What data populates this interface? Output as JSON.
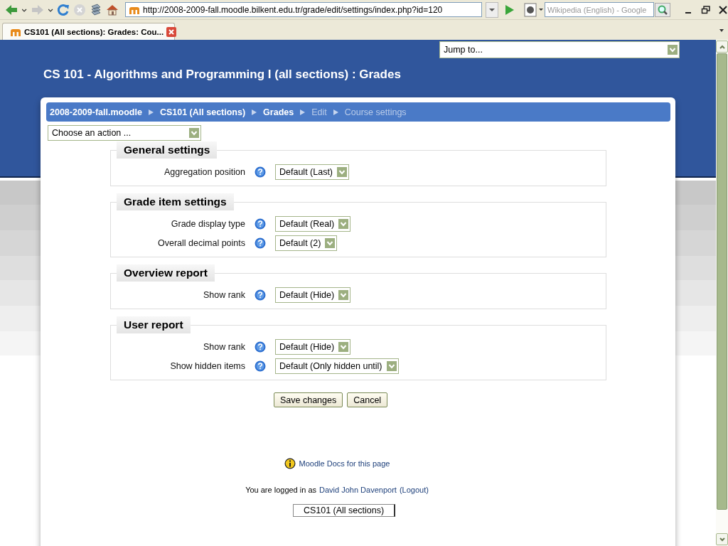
{
  "browser": {
    "address": "http://2008-2009-fall.moodle.bilkent.edu.tr/grade/edit/settings/index.php?id=120",
    "search_placeholder": "Wikipedia (English) - Google",
    "tabs": [
      {
        "title": "CS101 (All sections): Grades: Cou...",
        "selected": true
      }
    ]
  },
  "page": {
    "jump_to": "Jump to...",
    "course_title": "CS 101 - Algorithms and Programming I (all sections) : Grades",
    "breadcrumb": [
      {
        "label": "2008-2009-fall.moodle",
        "link": true
      },
      {
        "label": "CS101 (All sections)",
        "link": true
      },
      {
        "label": "Grades",
        "link": true
      },
      {
        "label": "Edit",
        "link": false
      },
      {
        "label": "Course settings",
        "link": false
      }
    ],
    "action_select": "Choose an action ...",
    "sections": [
      {
        "title": "General settings",
        "settings": [
          {
            "label": "Aggregation position",
            "value": "Default (Last)"
          }
        ]
      },
      {
        "title": "Grade item settings",
        "settings": [
          {
            "label": "Grade display type",
            "value": "Default (Real)"
          },
          {
            "label": "Overall decimal points",
            "value": "Default (2)"
          }
        ]
      },
      {
        "title": "Overview report",
        "settings": [
          {
            "label": "Show rank",
            "value": "Default (Hide)"
          }
        ]
      },
      {
        "title": "User report",
        "settings": [
          {
            "label": "Show rank",
            "value": "Default (Hide)"
          },
          {
            "label": "Show hidden items",
            "value": "Default (Only hidden until)"
          }
        ]
      }
    ],
    "buttons": [
      "Save changes",
      "Cancel"
    ],
    "docs_link": "Moodle Docs for this page",
    "login": {
      "prefix": "You are logged in as",
      "user": "David John Davenport",
      "logout": "(Logout)"
    },
    "footer_select": "CS101 (All sections)"
  }
}
